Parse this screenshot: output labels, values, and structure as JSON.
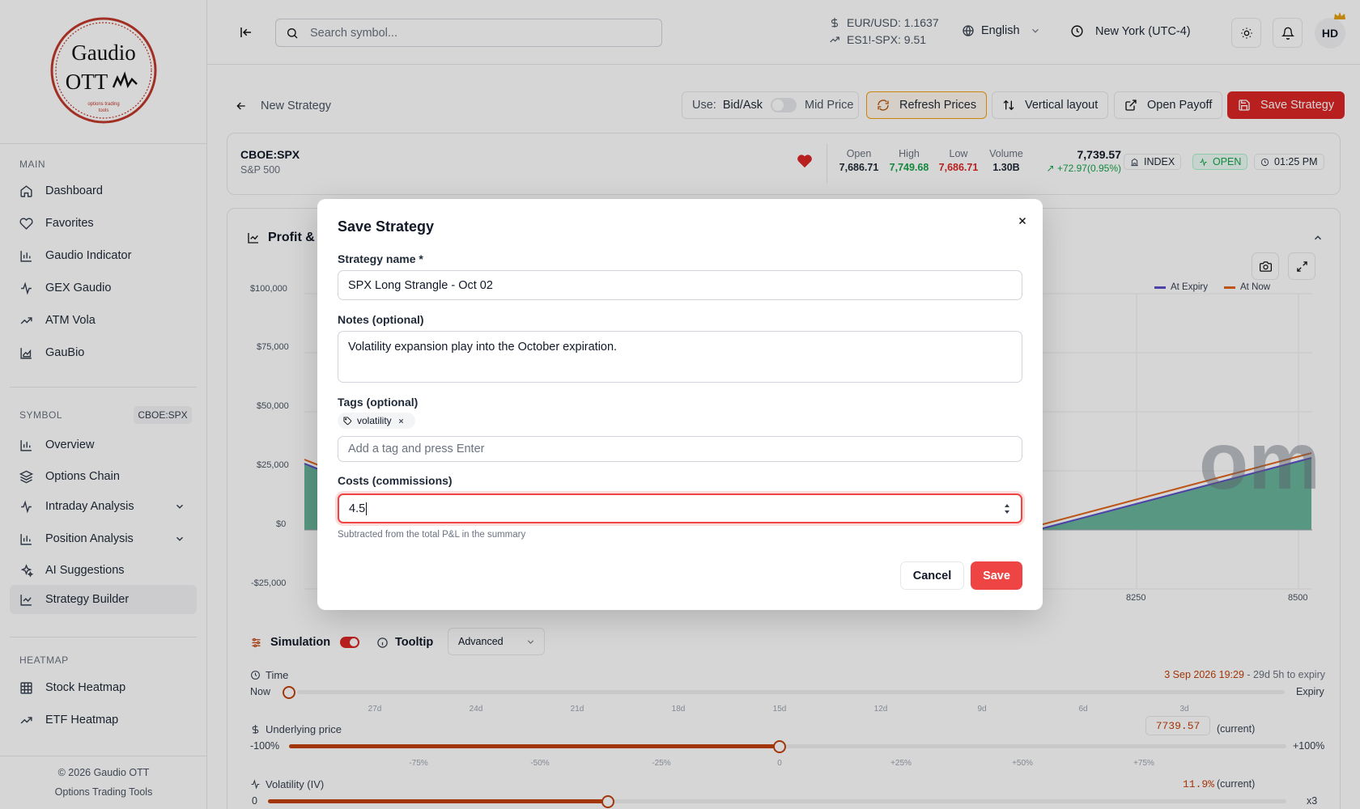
{
  "sidebar": {
    "logo_text_1": "Gaudio",
    "logo_text_2": "OTT",
    "logo_tagline": "options trading tools",
    "sections": {
      "main": "MAIN",
      "symbol": "SYMBOL",
      "heatmap": "HEATMAP"
    },
    "symbol_badge": "CBOE:SPX",
    "main_items": [
      {
        "label": "Dashboard",
        "icon": "home-icon"
      },
      {
        "label": "Favorites",
        "icon": "heart-icon"
      },
      {
        "label": "Gaudio Indicator",
        "icon": "chart-bar-icon"
      },
      {
        "label": "GEX Gaudio",
        "icon": "activity-icon"
      },
      {
        "label": "ATM Vola",
        "icon": "trend-icon"
      },
      {
        "label": "GauBio",
        "icon": "chart-area-icon"
      }
    ],
    "symbol_items": [
      {
        "label": "Overview",
        "icon": "chart-bar-icon"
      },
      {
        "label": "Options Chain",
        "icon": "layers-icon"
      },
      {
        "label": "Intraday Analysis",
        "icon": "activity-icon"
      },
      {
        "label": "Position Analysis",
        "icon": "chart-bar-icon"
      },
      {
        "label": "AI Suggestions",
        "icon": "sparkles-icon"
      },
      {
        "label": "Strategy Builder",
        "icon": "line-chart-icon"
      }
    ],
    "heatmap_items": [
      {
        "label": "Stock Heatmap",
        "icon": "grid-icon"
      },
      {
        "label": "ETF Heatmap",
        "icon": "trend-icon"
      }
    ],
    "footer_1": "© 2026 Gaudio OTT",
    "footer_2": "Options Trading Tools"
  },
  "topbar": {
    "search_placeholder": "Search symbol...",
    "ticker_1": "EUR/USD: 1.1637",
    "ticker_2": "ES1!-SPX: 9.51",
    "language": "English",
    "timezone": "New York (UTC-4)",
    "avatar": "HD"
  },
  "toolbar": {
    "back_label": "New Strategy",
    "use_label": "Use:",
    "bid_ask": "Bid/Ask",
    "mid_price": "Mid Price",
    "refresh": "Refresh Prices",
    "vertical_layout": "Vertical layout",
    "open_payoff": "Open Payoff",
    "save_strategy": "Save Strategy"
  },
  "quote": {
    "symbol": "CBOE:SPX",
    "name": "S&P 500",
    "open_label": "Open",
    "open": "7,686.71",
    "high_label": "High",
    "high": "7,749.68",
    "low_label": "Low",
    "low": "7,686.71",
    "volume_label": "Volume",
    "volume": "1.30B",
    "last": "7,739.57",
    "change": "+72.97(0.95%)",
    "type": "INDEX",
    "status": "OPEN",
    "time": "01:25 PM"
  },
  "chart_panel": {
    "title": "Profit & L",
    "watermark": "om",
    "legend": [
      "At Expiry",
      "At Now"
    ]
  },
  "chart_data": {
    "type": "area",
    "y_ticks": [
      "$100,000",
      "$75,000",
      "$50,000",
      "$25,000",
      "$0",
      "-$25,000"
    ],
    "ylim": [
      -25000,
      100000
    ],
    "x_ticks": [
      "8250",
      "8500"
    ],
    "series": [
      {
        "name": "At Expiry",
        "color": "#5b4fc9"
      },
      {
        "name": "At Now",
        "color": "#e0661c"
      }
    ]
  },
  "controls": {
    "simulation": "Simulation",
    "tooltip": "Tooltip",
    "tooltip_mode": "Advanced",
    "time_label": "Time",
    "time_date": "3 Sep 2026 19:29",
    "time_remaining": " - 29d 5h to expiry",
    "time_now": "Now",
    "time_expiry": "Expiry",
    "time_ticks": [
      "27d",
      "24d",
      "21d",
      "18d",
      "15d",
      "12d",
      "9d",
      "6d",
      "3d"
    ],
    "underlying_label": "Underlying price",
    "underlying_value": "7739.57",
    "current": "(current)",
    "underlying_min": "-100%",
    "underlying_max": "+100%",
    "underlying_ticks": [
      "-75%",
      "-50%",
      "-25%",
      "0",
      "+25%",
      "+50%",
      "+75%"
    ],
    "vol_label": "Volatility (IV)",
    "vol_value": "11.9%",
    "vol_min": "0",
    "vol_max": "x3"
  },
  "modal": {
    "title": "Save Strategy",
    "name_label": "Strategy name *",
    "name_value": "SPX Long Strangle - Oct 02",
    "notes_label": "Notes (optional)",
    "notes_value": "Volatility expansion play into the October expiration.",
    "tags_label": "Tags (optional)",
    "tag": "volatility",
    "tag_placeholder": "Add a tag and press Enter",
    "costs_label": "Costs (commissions)",
    "costs_value": "4.5",
    "costs_help": "Subtracted from the total P&L in the summary",
    "cancel": "Cancel",
    "save": "Save"
  }
}
